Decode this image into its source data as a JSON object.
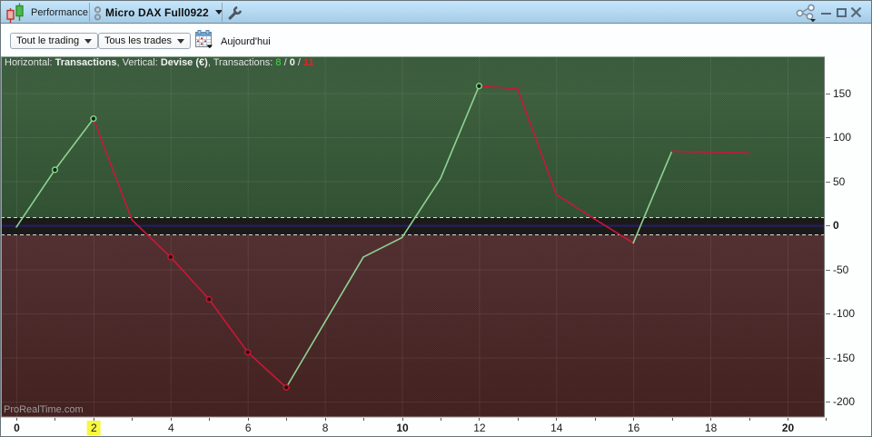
{
  "window": {
    "tab_label": "Performance",
    "instrument": "Micro DAX Full0922"
  },
  "toolbar": {
    "trading_filter": "Tout le trading",
    "trades_filter": "Tous les trades",
    "date_label": "Aujourd'hui"
  },
  "legend": {
    "horizontal_label": "Horizontal:",
    "horizontal_value": "Transactions",
    "vertical_label": "Vertical:",
    "vertical_value": "Devise (€)",
    "transactions_label": "Transactions:",
    "wins": "8",
    "neutral": "0",
    "losses": "11"
  },
  "watermark": "ProRealTime.com",
  "chart_data": {
    "type": "line",
    "xlabel": "Transactions",
    "ylabel": "Devise (€)",
    "x": [
      0,
      1,
      2,
      3,
      4,
      5,
      6,
      7,
      8,
      9,
      10,
      11,
      12,
      13,
      14,
      15,
      16,
      17,
      18,
      19
    ],
    "values": [
      -2,
      63,
      121,
      6,
      -36,
      -84,
      -144,
      -184,
      -110,
      -36,
      -14,
      53,
      158,
      155,
      35,
      7,
      -20,
      84,
      83,
      82
    ],
    "markers": [
      {
        "t": 1,
        "kind": "gain"
      },
      {
        "t": 2,
        "kind": "gain"
      },
      {
        "t": 4,
        "kind": "loss"
      },
      {
        "t": 5,
        "kind": "loss"
      },
      {
        "t": 6,
        "kind": "loss"
      },
      {
        "t": 7,
        "kind": "loss"
      },
      {
        "t": 12,
        "kind": "gain"
      }
    ],
    "yticks": [
      150,
      100,
      50,
      0,
      -50,
      -100,
      -150,
      -200
    ],
    "bold_yticks": [
      0
    ],
    "xticks": [
      0,
      2,
      4,
      6,
      8,
      10,
      12,
      14,
      16,
      18,
      20
    ],
    "bold_xticks": [
      0,
      10,
      20
    ],
    "highlighted_xtick": 2,
    "ylim": [
      -216,
      191
    ],
    "xlim": [
      -0.4,
      21
    ],
    "colors": {
      "up_line": "#8ed392",
      "down_line": "#c81738",
      "gain_marker_fill": "#04300a",
      "loss_marker_fill": "#2e1008",
      "zero_line": "#241e72",
      "profit_zone_top": "#385a3b",
      "profit_zone_mid": "#3a5e3a",
      "profit_zone_bottom": "#2d4f2f",
      "loss_zone_top": "#502c2e",
      "loss_zone_bottom": "#401d1c",
      "zero_band": "#1b1a18",
      "dashed_line": "#d9ded9",
      "highlight_tick_bg": "#f8f83e"
    }
  }
}
